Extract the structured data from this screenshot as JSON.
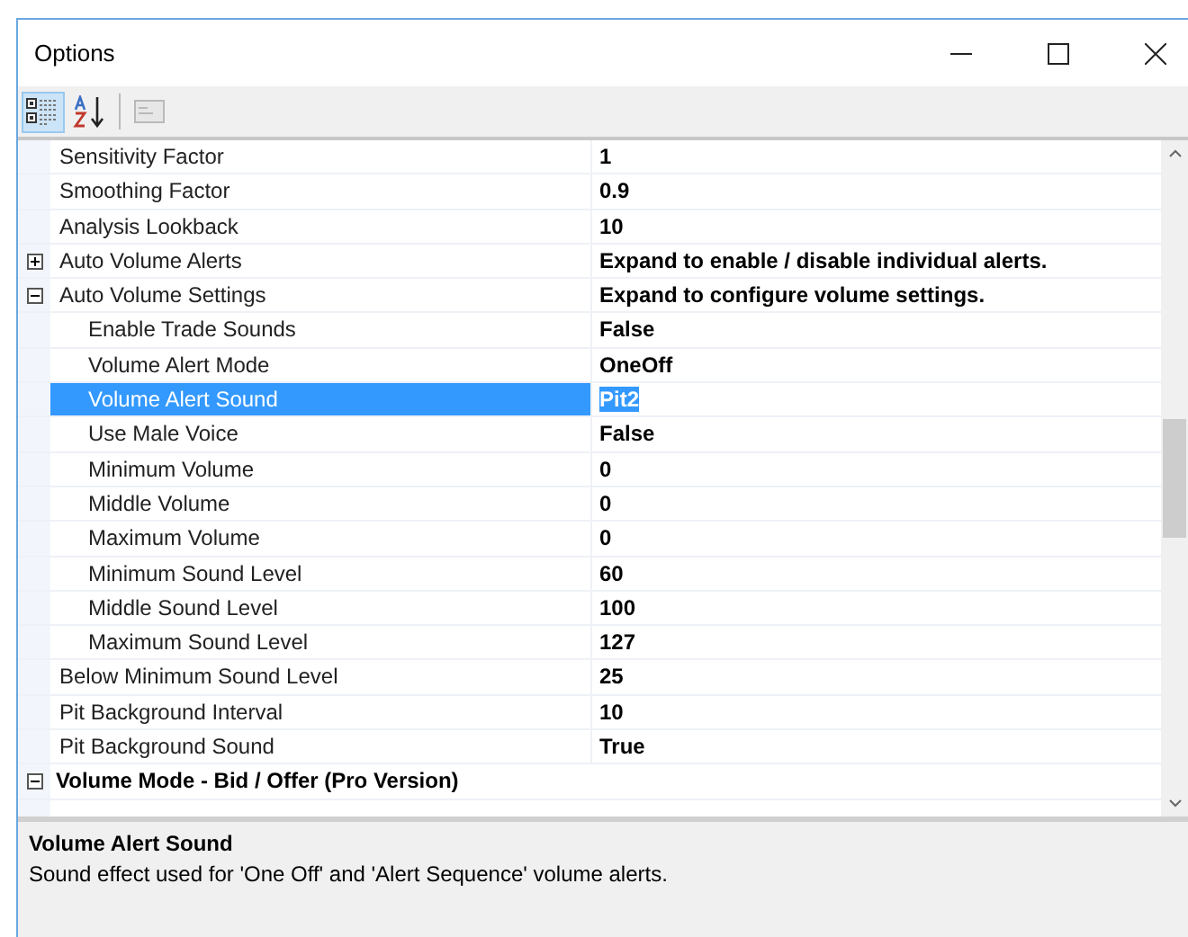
{
  "window": {
    "title": "Options"
  },
  "toolbar": [
    {
      "kind": "categorized",
      "selected": true,
      "disabled": false
    },
    {
      "kind": "alphabetical",
      "selected": false,
      "disabled": false
    },
    {
      "kind": "property-pages",
      "selected": false,
      "disabled": true
    }
  ],
  "grid": {
    "rows": [
      {
        "kind": "property",
        "name": "Sensitivity Factor",
        "value": "1",
        "selected": false
      },
      {
        "kind": "property",
        "name": "Smoothing Factor",
        "value": "0.9",
        "selected": false
      },
      {
        "kind": "property",
        "name": "Analysis Lookback",
        "value": "10",
        "selected": false
      },
      {
        "kind": "property",
        "name": "Auto Volume Alerts",
        "value": "Expand to enable / disable individual alerts.",
        "selected": false,
        "expanded": false
      },
      {
        "kind": "property",
        "name": "Auto Volume Settings",
        "value": "Expand to configure volume settings.",
        "selected": false,
        "expanded": true,
        "children": [
          {
            "kind": "property",
            "name": "Enable Trade Sounds",
            "value": "False",
            "selected": false
          },
          {
            "kind": "property",
            "name": "Volume Alert Mode",
            "value": "OneOff",
            "selected": false
          },
          {
            "kind": "property",
            "name": "Volume Alert Sound",
            "value": "Pit2",
            "selected": true
          },
          {
            "kind": "property",
            "name": "Use Male Voice",
            "value": "False",
            "selected": false
          },
          {
            "kind": "property",
            "name": "Minimum Volume",
            "value": "0",
            "selected": false
          },
          {
            "kind": "property",
            "name": "Middle Volume",
            "value": "0",
            "selected": false
          },
          {
            "kind": "property",
            "name": "Maximum Volume",
            "value": "0",
            "selected": false
          },
          {
            "kind": "property",
            "name": "Minimum Sound Level",
            "value": "60",
            "selected": false
          },
          {
            "kind": "property",
            "name": "Middle Sound Level",
            "value": "100",
            "selected": false
          },
          {
            "kind": "property",
            "name": "Maximum Sound Level",
            "value": "127",
            "selected": false
          }
        ]
      },
      {
        "kind": "property",
        "name": "Below Minimum Sound Level",
        "value": "25",
        "selected": false
      },
      {
        "kind": "property",
        "name": "Pit Background Interval",
        "value": "10",
        "selected": false
      },
      {
        "kind": "property",
        "name": "Pit Background Sound",
        "value": "True",
        "selected": false
      },
      {
        "kind": "category",
        "name": "Volume Mode - Bid / Offer (Pro Version)",
        "selected": false,
        "expanded": true
      }
    ]
  },
  "description": {
    "title": "Volume Alert Sound",
    "text": "Sound effect used for 'One Off' and 'Alert Sequence' volume alerts."
  }
}
